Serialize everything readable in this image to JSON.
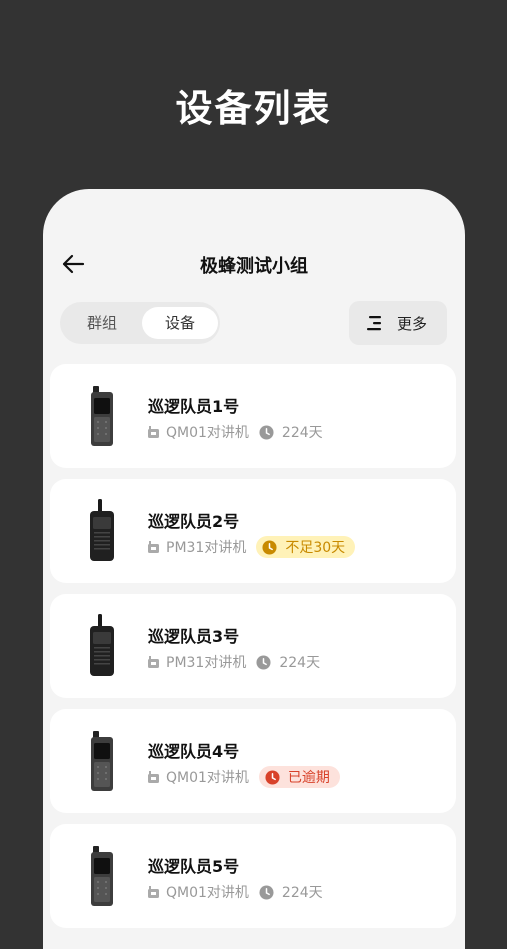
{
  "page_title": "设备列表",
  "header": {
    "title": "极蜂测试小组"
  },
  "tabs": [
    {
      "label": "群组",
      "active": false
    },
    {
      "label": "设备",
      "active": true
    }
  ],
  "more_button": {
    "label": "更多"
  },
  "colors": {
    "background": "#333333",
    "screen": "#f4f4f4",
    "warn_bg": "#fff2b8",
    "warn_text": "#c88a00",
    "overdue_bg": "#fde2dc",
    "overdue_text": "#d8422a"
  },
  "devices": [
    {
      "name": "巡逻队员1号",
      "model": "QM01对讲机",
      "status": "224天",
      "status_type": "normal",
      "image": "walkie-talkie-wide"
    },
    {
      "name": "巡逻队员2号",
      "model": "PM31对讲机",
      "status": "不足30天",
      "status_type": "warn",
      "image": "walkie-talkie-antenna"
    },
    {
      "name": "巡逻队员3号",
      "model": "PM31对讲机",
      "status": "224天",
      "status_type": "normal",
      "image": "walkie-talkie-antenna"
    },
    {
      "name": "巡逻队员4号",
      "model": "QM01对讲机",
      "status": "已逾期",
      "status_type": "overdue",
      "image": "walkie-talkie-wide"
    },
    {
      "name": "巡逻队员5号",
      "model": "QM01对讲机",
      "status": "224天",
      "status_type": "normal",
      "image": "walkie-talkie-wide"
    }
  ]
}
